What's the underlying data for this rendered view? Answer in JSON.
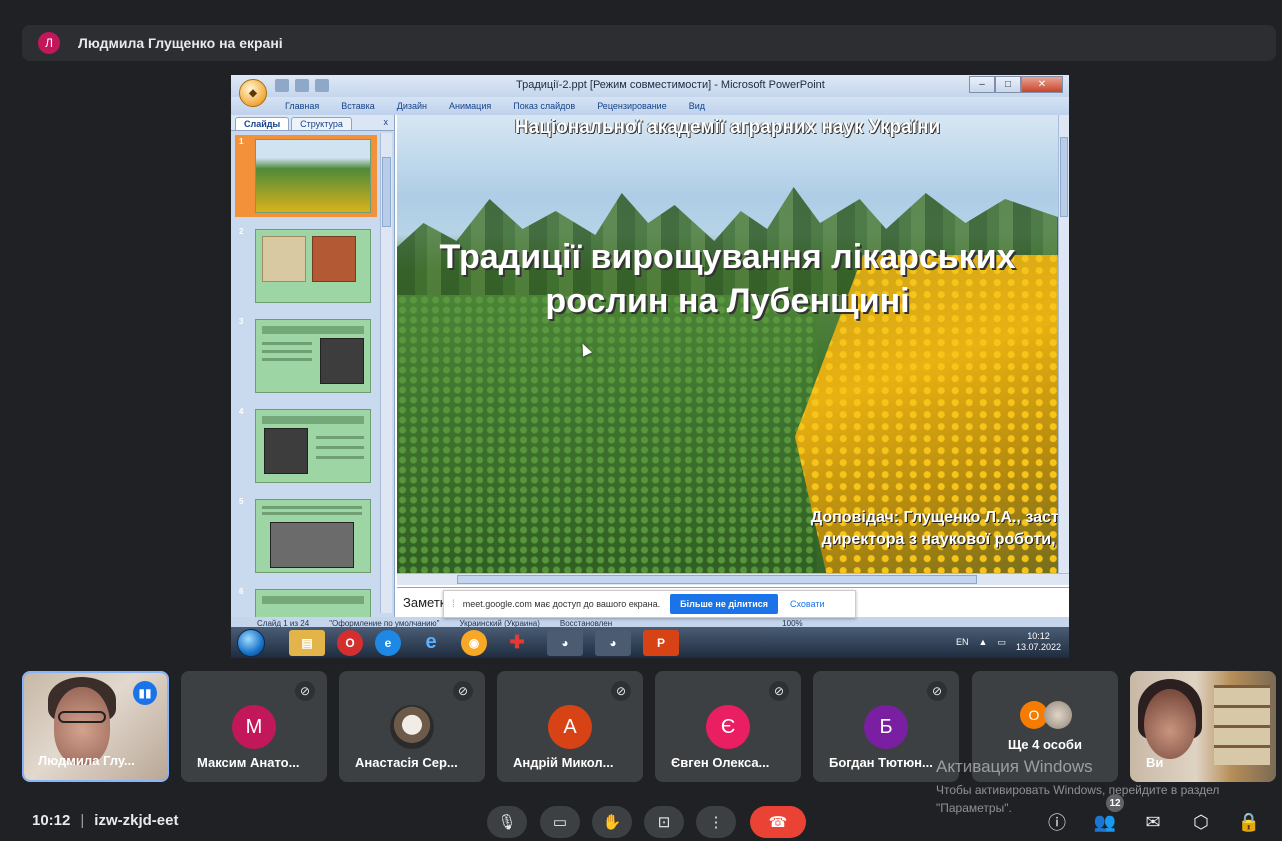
{
  "presenter": {
    "initial": "Л",
    "text": "Людмила Глущенко на екрані"
  },
  "ppt": {
    "window_title": "Традиції-2.ppt [Режим совместимости] - Microsoft PowerPoint",
    "tabs": [
      "Главная",
      "Вставка",
      "Дизайн",
      "Анимация",
      "Показ слайдов",
      "Рецензирование",
      "Вид"
    ],
    "pane_tabs": [
      "Слайды",
      "Структура"
    ],
    "thumbs": [
      "1",
      "2",
      "3",
      "4",
      "5",
      "6"
    ],
    "slide": {
      "top_text": "Національної академії аграрних наук України",
      "title_line1": "Традиції вирощування лікарських",
      "title_line2": "рослин на Лубенщині",
      "speaker_line1": "Доповідач: Глущенко Л.А., засту",
      "speaker_line2": "директора з наукової роботи, к"
    },
    "notes_label": "Заметки",
    "status": {
      "slide": "Слайд 1 из 24",
      "theme": "\"Оформление по умолчанию\"",
      "lang": "Украинский (Украина)",
      "state": "Восстановлен",
      "zoom": "100%"
    },
    "tray": {
      "lang": "EN",
      "time": "10:12",
      "date": "13.07.2022"
    }
  },
  "share_popup": {
    "text": "meet.google.com має доступ до вашого екрана.",
    "stop_label": "Більше не ділитися",
    "hide_label": "Сховати"
  },
  "participants": [
    {
      "name": "Людмила Глу...",
      "self": true
    },
    {
      "name": "Максим Анато...",
      "initial": "М",
      "color": "#c2185b"
    },
    {
      "name": "Анастасія Сер...",
      "initial": "",
      "color": "#8d7b6a"
    },
    {
      "name": "Андрій Микол...",
      "initial": "А",
      "color": "#d84315"
    },
    {
      "name": "Євген Олекса...",
      "initial": "Є",
      "color": "#e91e63"
    },
    {
      "name": "Богдан Тютюн...",
      "initial": "Б",
      "color": "#7b1fa2"
    }
  ],
  "more": {
    "label": "Ще 4 особи",
    "initial": "О",
    "color": "#f57c00"
  },
  "last_tile": {
    "name": "Ви"
  },
  "watermark": {
    "title": "Активация Windows",
    "sub": "Чтобы активировать Windows, перейдите в раздел \"Параметры\"."
  },
  "meeting": {
    "time": "10:12",
    "code": "izw-zkjd-eet"
  },
  "participant_count": "12",
  "colors": {
    "end_call": "#ea4335",
    "accent": "#1a73e8",
    "tile_bg": "#3c4043"
  }
}
